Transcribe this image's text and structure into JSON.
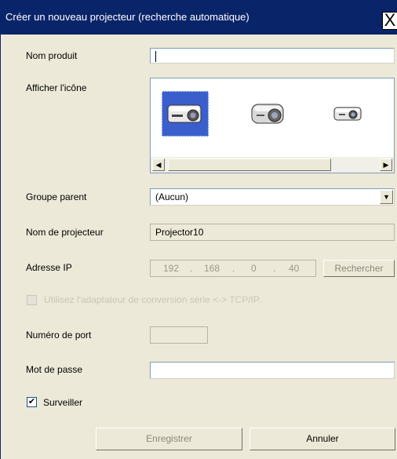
{
  "dialog": {
    "title": "Créer un nouveau projecteur (recherche automatique)",
    "close_glyph": "X"
  },
  "fields": {
    "product_name": {
      "label": "Nom produit",
      "value": ""
    },
    "show_icon": {
      "label": "Afficher l'icône",
      "icons": [
        "projector-large-icon",
        "projector-medium-icon",
        "projector-small-icon"
      ],
      "selected_index": 0
    },
    "parent_group": {
      "label": "Groupe parent",
      "value": "(Aucun)"
    },
    "projector_name": {
      "label": "Nom de projecteur",
      "value": "Projector10"
    },
    "ip_address": {
      "label": "Adresse IP",
      "octets": [
        "192",
        "168",
        "0",
        "40"
      ],
      "search_label": "Rechercher"
    },
    "adapter": {
      "label": "Utilisez l'adaptateur de conversion série <-> TCP/IP.",
      "checked": false
    },
    "port_number": {
      "label": "Numéro de port",
      "value": ""
    },
    "password": {
      "label": "Mot de passe",
      "value": ""
    },
    "monitor": {
      "label": "Surveiller",
      "checked": true
    }
  },
  "buttons": {
    "save": "Enregistrer",
    "cancel": "Annuler"
  },
  "colors": {
    "titlebar": "#0a246a",
    "dialog_bg": "#ece9d8",
    "selection": "#3a5fcd"
  }
}
